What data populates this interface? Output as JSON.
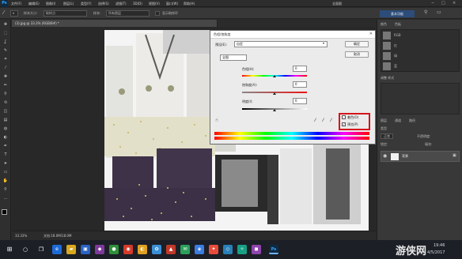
{
  "menubar": {
    "logo": "Ps",
    "items": [
      "文件(F)",
      "编辑(E)",
      "图像(I)",
      "图层(L)",
      "类型(Y)",
      "选择(S)",
      "滤镜(T)",
      "3D(D)",
      "视图(V)",
      "窗口(W)",
      "帮助(H)"
    ],
    "workspace": "全面图",
    "window_controls": [
      "−",
      "□",
      "×"
    ]
  },
  "optbar": {
    "tool_preset": "▾",
    "size_label": "样本大小:",
    "size_value": "取样点",
    "sample_label": "样本:",
    "sample_value": "所有图层",
    "show_ring": "显示取样环",
    "basic_button": "基本功能"
  },
  "toolbar": {
    "tools": [
      "move",
      "marquee",
      "lasso",
      "quick-select",
      "crop",
      "eyedropper",
      "healing",
      "brush",
      "clone-stamp",
      "history-brush",
      "eraser",
      "gradient",
      "blur",
      "dodge",
      "pen",
      "type",
      "path-select",
      "shape",
      "hand",
      "zoom",
      "more"
    ],
    "glyphs": [
      "✥",
      "⬚",
      "ʆ",
      "✎",
      "⌗",
      "⁄",
      "✚",
      "✏",
      "⚲",
      "⟲",
      "◫",
      "▤",
      "◍",
      "◐",
      "✒",
      "T",
      "➤",
      "▭",
      "✋",
      "⚲",
      "…"
    ]
  },
  "document": {
    "tab_title": "(3).jpg @ 33.3% (RGB/8#) *",
    "zoom": "33.33%",
    "doc_size": "文档:18.0M/18.0M"
  },
  "panels": {
    "tabs_top": [
      "颜色",
      "色板"
    ],
    "channels": [
      "RGB",
      "红",
      "绿",
      "蓝"
    ],
    "section": "调整 样式",
    "layers_tabs": [
      "图层",
      "通道",
      "路径"
    ],
    "kind_label": "类型",
    "blend_mode": "正常",
    "opacity_label": "不透明度:",
    "lock_label": "锁定:",
    "fill_label": "填充:",
    "layer_name": "背景"
  },
  "dialog": {
    "title": "色相/饱和度",
    "preset_label": "预设(E):",
    "preset_value": "自定",
    "channel": "全图",
    "hue_label": "色相(H):",
    "hue_value": "0",
    "sat_label": "饱和度(A):",
    "sat_value": "0",
    "light_label": "明度(I):",
    "light_value": "0",
    "ok_button": "确定",
    "cancel_button": "取消",
    "colorize_label": "着色(O)",
    "preview_label": "预览(P)",
    "colorize_checked": false,
    "preview_checked": true,
    "highlight_color": "#d4141c"
  },
  "taskbar": {
    "time": "19:46",
    "date": "4/5/2017",
    "watermark": "游侠网"
  }
}
